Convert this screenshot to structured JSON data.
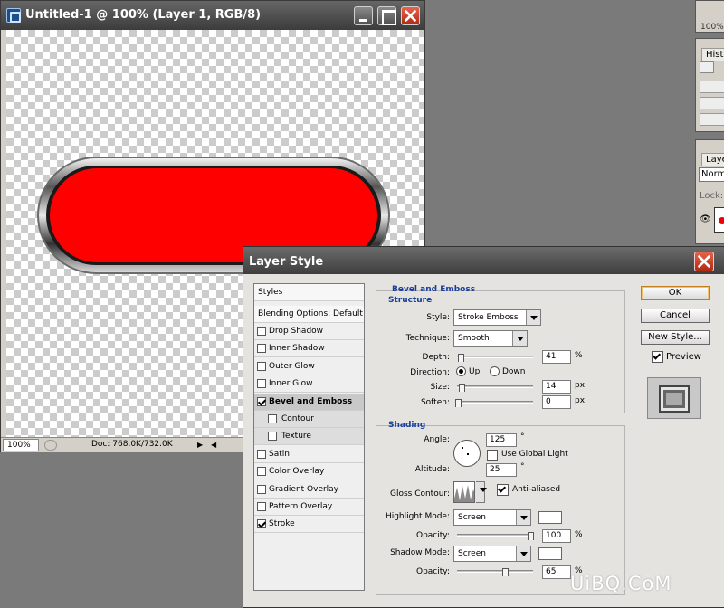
{
  "document": {
    "title": "Untitled-1 @ 100% (Layer 1, RGB/8)",
    "zoom": "100%",
    "doc_size": "Doc: 768.0K/732.0K"
  },
  "right_panels": {
    "zoom_value": "100%",
    "history_tab": "Histo",
    "layers_tab": "Layer",
    "blend_mode": "Norma",
    "lock_label": "Lock:"
  },
  "dialog": {
    "title": "Layer Style",
    "styles_list": {
      "header": "Styles",
      "blending_options": "Blending Options: Default",
      "items": [
        {
          "label": "Drop Shadow",
          "checked": false,
          "sub": false,
          "active": false
        },
        {
          "label": "Inner Shadow",
          "checked": false,
          "sub": false,
          "active": false
        },
        {
          "label": "Outer Glow",
          "checked": false,
          "sub": false,
          "active": false
        },
        {
          "label": "Inner Glow",
          "checked": false,
          "sub": false,
          "active": false
        },
        {
          "label": "Bevel and Emboss",
          "checked": true,
          "sub": false,
          "active": true
        },
        {
          "label": "Contour",
          "checked": false,
          "sub": true,
          "active": false
        },
        {
          "label": "Texture",
          "checked": false,
          "sub": true,
          "active": false
        },
        {
          "label": "Satin",
          "checked": false,
          "sub": false,
          "active": false
        },
        {
          "label": "Color Overlay",
          "checked": false,
          "sub": false,
          "active": false
        },
        {
          "label": "Gradient Overlay",
          "checked": false,
          "sub": false,
          "active": false
        },
        {
          "label": "Pattern Overlay",
          "checked": false,
          "sub": false,
          "active": false
        },
        {
          "label": "Stroke",
          "checked": true,
          "sub": false,
          "active": false
        }
      ]
    },
    "bevel": {
      "section_title": "Bevel and Emboss",
      "structure_title": "Structure",
      "style_label": "Style:",
      "style_value": "Stroke Emboss",
      "technique_label": "Technique:",
      "technique_value": "Smooth",
      "depth_label": "Depth:",
      "depth_value": "41",
      "depth_unit": "%",
      "direction_label": "Direction:",
      "direction_up": "Up",
      "direction_down": "Down",
      "size_label": "Size:",
      "size_value": "14",
      "size_unit": "px",
      "soften_label": "Soften:",
      "soften_value": "0",
      "soften_unit": "px"
    },
    "shading": {
      "title": "Shading",
      "angle_label": "Angle:",
      "angle_value": "125",
      "angle_unit": "°",
      "global_light_label": "Use Global Light",
      "altitude_label": "Altitude:",
      "altitude_value": "25",
      "altitude_unit": "°",
      "gloss_contour_label": "Gloss Contour:",
      "anti_aliased_label": "Anti-aliased",
      "highlight_mode_label": "Highlight Mode:",
      "highlight_mode_value": "Screen",
      "highlight_opacity_label": "Opacity:",
      "highlight_opacity_value": "100",
      "highlight_opacity_unit": "%",
      "shadow_mode_label": "Shadow Mode:",
      "shadow_mode_value": "Screen",
      "shadow_opacity_label": "Opacity:",
      "shadow_opacity_value": "65",
      "shadow_opacity_unit": "%"
    },
    "buttons": {
      "ok": "OK",
      "cancel": "Cancel",
      "new_style": "New Style...",
      "preview": "Preview"
    }
  },
  "watermark": "UiBQ.CoM",
  "colors": {
    "shape_fill": "#ff0000",
    "section_title": "#1a3f9a",
    "close_button": "#c8391f"
  }
}
